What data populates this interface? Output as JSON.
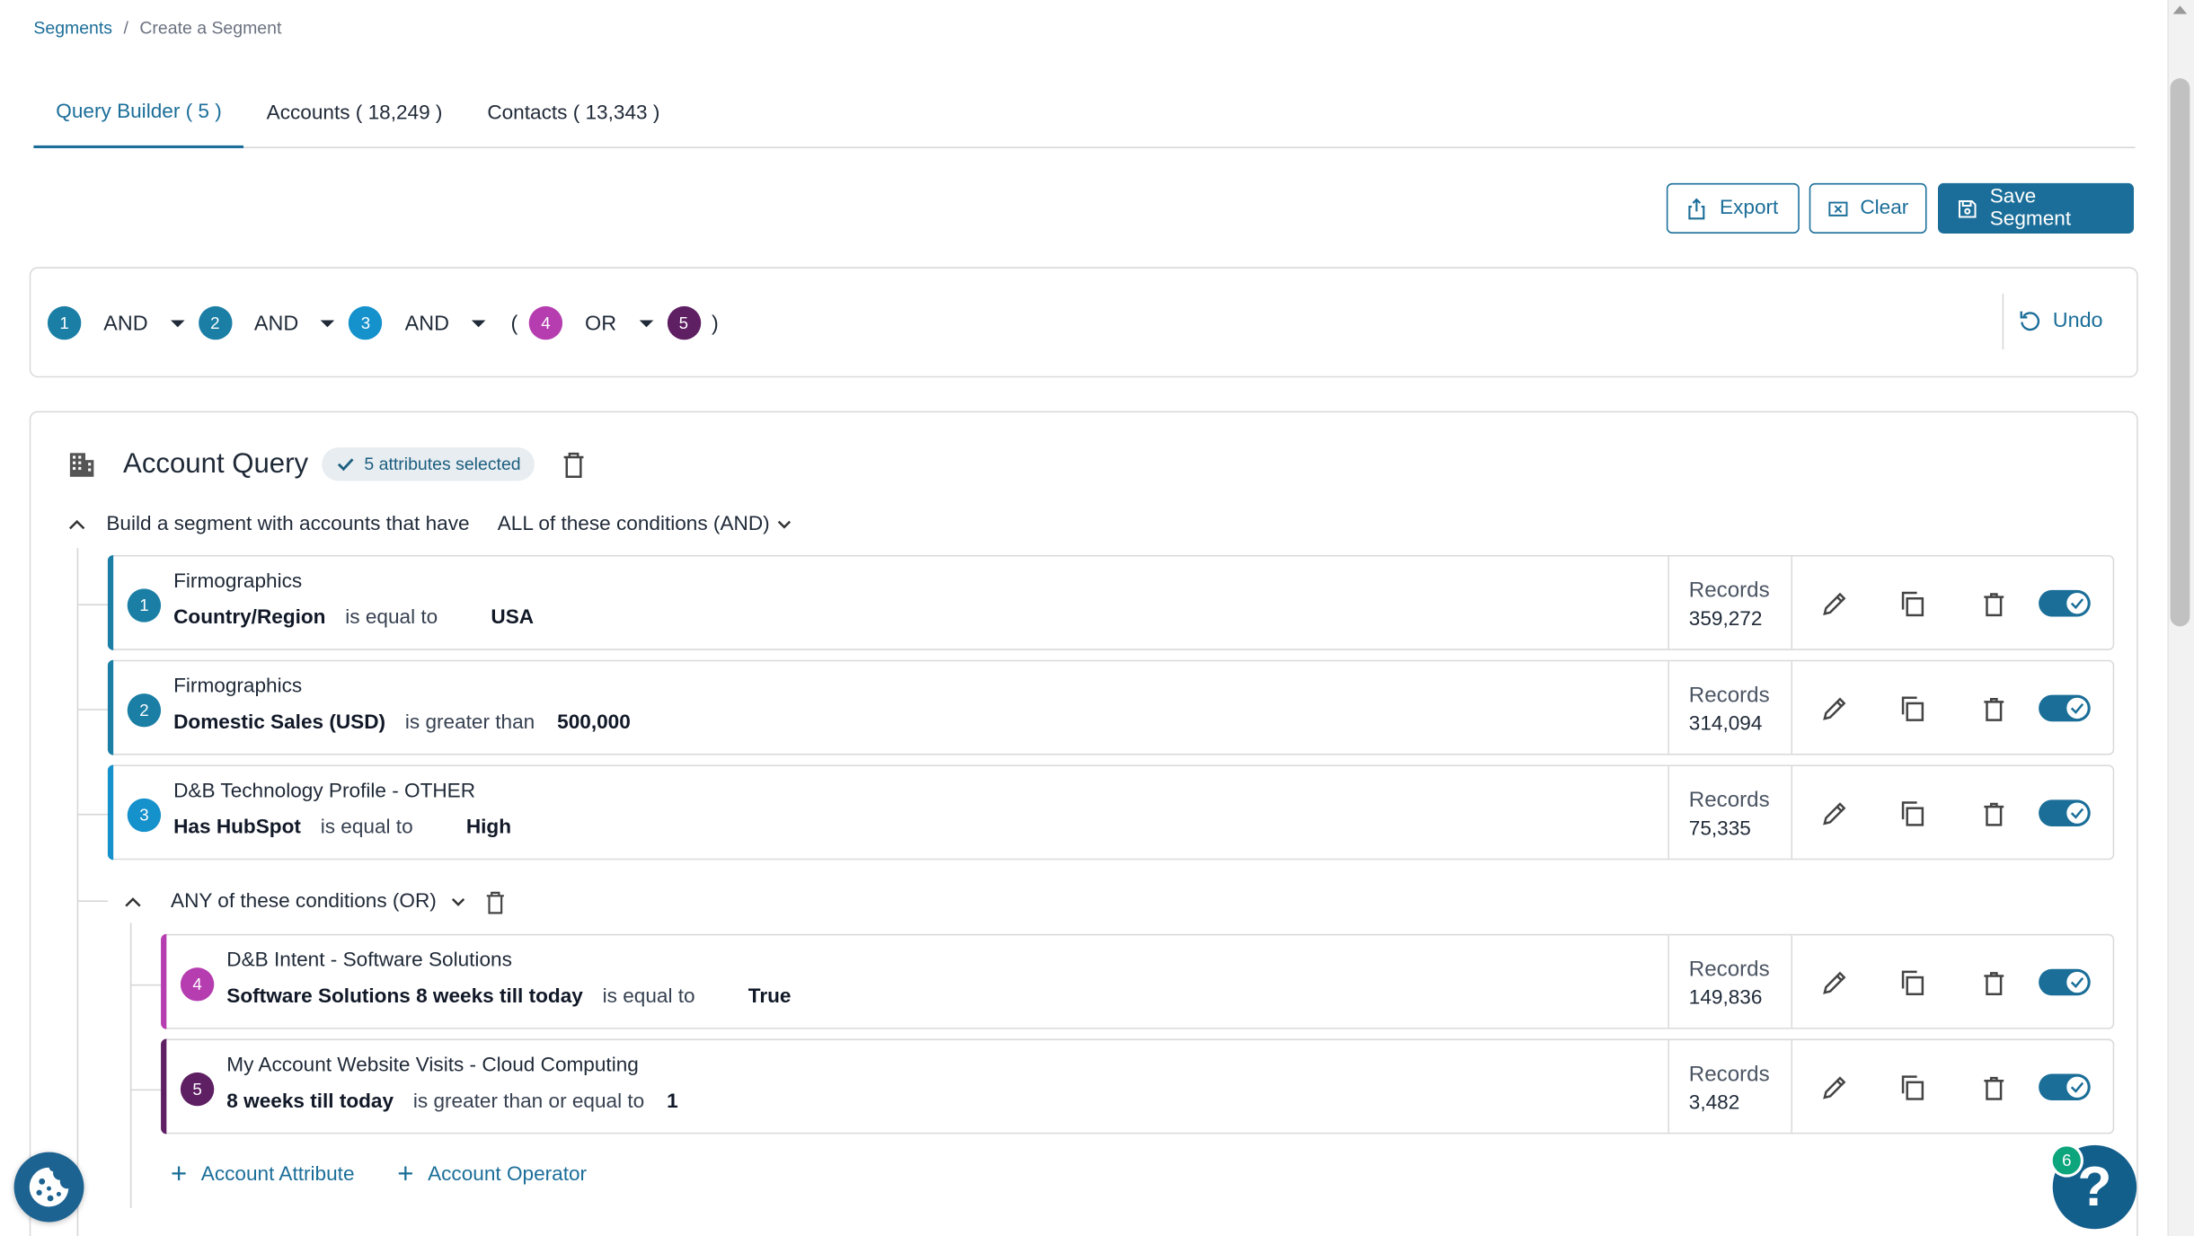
{
  "breadcrumb": {
    "root": "Segments",
    "separator": "/",
    "current": "Create a Segment"
  },
  "tabs": [
    {
      "label": "Query Builder ( 5 )",
      "active": true
    },
    {
      "label": "Accounts ( 18,249 )",
      "active": false
    },
    {
      "label": "Contacts ( 13,343 )",
      "active": false
    }
  ],
  "toolbar": {
    "export_label": "Export",
    "clear_label": "Clear",
    "save_label": "Save Segment"
  },
  "expression": {
    "items": [
      "1",
      "AND",
      "2",
      "AND",
      "3",
      "AND",
      "(",
      "4",
      "OR",
      "5",
      ")"
    ],
    "operators": [
      "AND",
      "AND",
      "AND",
      "OR"
    ],
    "numbers": [
      "1",
      "2",
      "3",
      "4",
      "5"
    ],
    "open_paren": "(",
    "close_paren": ")",
    "undo_label": "Undo"
  },
  "account_query": {
    "title": "Account Query",
    "chip": "5 attributes selected",
    "build_prefix": "Build a segment with accounts that have",
    "build_mode": "ALL of these conditions (AND)",
    "group_mode": "ANY of these conditions (OR)",
    "records_label": "Records",
    "conditions": [
      {
        "num": "1",
        "category": "Firmographics",
        "attribute": "Country/Region",
        "operator": "is equal to",
        "value": "USA",
        "records": "359,272"
      },
      {
        "num": "2",
        "category": "Firmographics",
        "attribute": "Domestic Sales (USD)",
        "operator": "is greater than",
        "value": "500,000",
        "records": "314,094"
      },
      {
        "num": "3",
        "category": "D&B Technology Profile - OTHER",
        "attribute": "Has HubSpot",
        "operator": "is equal to",
        "value": "High",
        "records": "75,335"
      },
      {
        "num": "4",
        "category": "D&B Intent - Software Solutions",
        "attribute": "Software Solutions 8 weeks till today",
        "operator": "is equal to",
        "value": "True",
        "records": "149,836"
      },
      {
        "num": "5",
        "category": "My Account Website Visits - Cloud Computing",
        "attribute": "8 weeks till today",
        "operator": "is greater than or equal to",
        "value": "1",
        "records": "3,482"
      }
    ],
    "add_attribute": "Account Attribute",
    "add_operator": "Account Operator"
  },
  "help": {
    "badge": "6",
    "glyph": "?"
  },
  "colors": {
    "accent": "#1b6e99",
    "teal": "#1a7ea5",
    "blue": "#1591cc",
    "pink": "#b53db0",
    "purple": "#5e1f63"
  }
}
